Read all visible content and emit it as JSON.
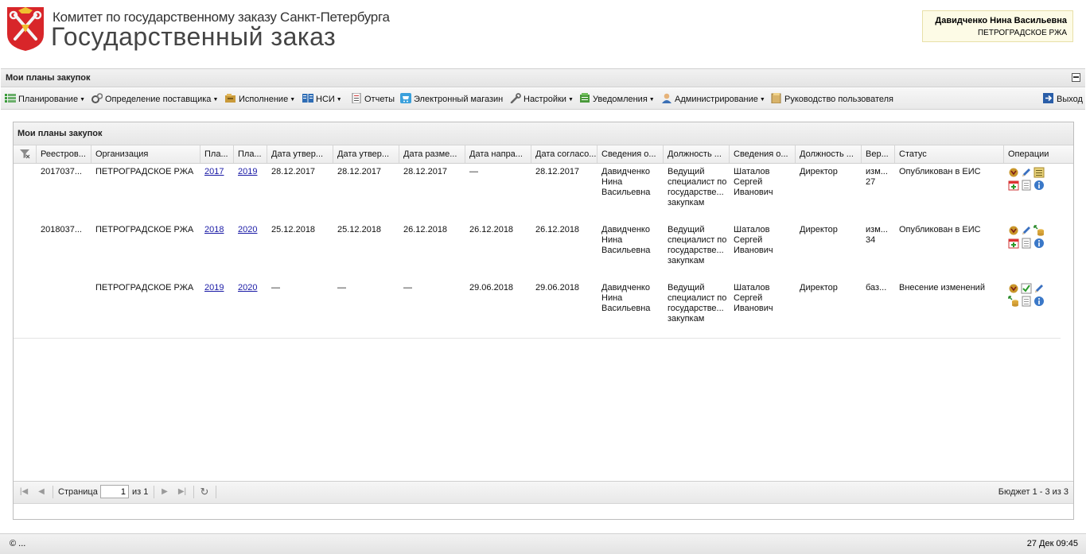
{
  "header": {
    "subtitle": "Комитет по государственному заказу Санкт-Петербурга",
    "title": "Государственный заказ"
  },
  "user": {
    "name": "Давидченко Нина Васильевна",
    "org": "ПЕТРОГРАДСКОЕ РЖА"
  },
  "page_title": "Мои планы закупок",
  "menu": [
    {
      "label": "Планирование",
      "icon": "planning-icon",
      "dropdown": true
    },
    {
      "label": "Определение поставщика",
      "icon": "gears-icon",
      "dropdown": true
    },
    {
      "label": "Исполнение",
      "icon": "execution-icon",
      "dropdown": true
    },
    {
      "label": "НСИ",
      "icon": "book-icon",
      "dropdown": true
    },
    {
      "label": "Отчеты",
      "icon": "report-icon",
      "dropdown": false
    },
    {
      "label": "Электронный магазин",
      "icon": "cart-icon",
      "dropdown": false
    },
    {
      "label": "Настройки",
      "icon": "wrench-icon",
      "dropdown": true
    },
    {
      "label": "Уведомления",
      "icon": "notification-icon",
      "dropdown": true
    },
    {
      "label": "Администрирование",
      "icon": "admin-user-icon",
      "dropdown": true
    },
    {
      "label": "Руководство пользователя",
      "icon": "manual-icon",
      "dropdown": false
    }
  ],
  "exit_label": "Выход",
  "panel_title": "Мои планы закупок",
  "columns": [
    "Реестров...",
    "Организация",
    "Пла...",
    "Пла...",
    "Дата утвер...",
    "Дата утвер...",
    "Дата разме...",
    "Дата напра...",
    "Дата согласо...",
    "Сведения о...",
    "Должность ...",
    "Сведения о...",
    "Должность ...",
    "Вер...",
    "Статус",
    "Операции"
  ],
  "rows": [
    {
      "reg": "2017037...",
      "org": "ПЕТРОГРАДСКОЕ РЖА",
      "plan_from": "2017",
      "plan_to": "2019",
      "d1": "28.12.2017",
      "d2": "28.12.2017",
      "d3": "28.12.2017",
      "d4": "—",
      "d5": "28.12.2017",
      "resp": "Давидченко Нина Васильевна",
      "resp_pos": "Ведущий специалист по государстве... закупкам",
      "head": "Шаталов Сергей Иванович",
      "head_pos": "Директор",
      "ver": "изм... 27",
      "status": "Опубликован в ЕИС",
      "ops": [
        "emblem-icon",
        "edit-pencil-icon",
        "document-list-icon",
        "add-calendar-icon",
        "page-icon",
        "info-icon"
      ]
    },
    {
      "reg": "2018037...",
      "org": "ПЕТРОГРАДСКОЕ РЖА",
      "plan_from": "2018",
      "plan_to": "2020",
      "d1": "25.12.2018",
      "d2": "25.12.2018",
      "d3": "26.12.2018",
      "d4": "26.12.2018",
      "d5": "26.12.2018",
      "resp": "Давидченко Нина Васильевна",
      "resp_pos": "Ведущий специалист по государстве... закупкам",
      "head": "Шаталов Сергей Иванович",
      "head_pos": "Директор",
      "ver": "изм... 34",
      "status": "Опубликован в ЕИС",
      "ops": [
        "emblem-icon",
        "edit-pencil-icon",
        "database-export-icon",
        "add-calendar-icon",
        "page-icon",
        "info-icon"
      ]
    },
    {
      "reg": "",
      "org": "ПЕТРОГРАДСКОЕ РЖА",
      "plan_from": "2019",
      "plan_to": "2020",
      "d1": "—",
      "d2": "—",
      "d3": "—",
      "d4": "29.06.2018",
      "d5": "29.06.2018",
      "resp": "Давидченко Нина Васильевна",
      "resp_pos": "Ведущий специалист по государстве... закупкам",
      "head": "Шаталов Сергей Иванович",
      "head_pos": "Директор",
      "ver": "баз...",
      "status": "Внесение изменений",
      "ops": [
        "emblem-icon",
        "approve-document-icon",
        "edit-pencil-icon",
        "database-export-icon",
        "page-icon",
        "info-icon"
      ]
    }
  ],
  "pager": {
    "page_label": "Страница",
    "page_value": "1",
    "of_label": "из 1",
    "summary": "Бюджет 1 - 3 из 3"
  },
  "footer": {
    "left": "© ...",
    "right": "27 Дек 09:45"
  }
}
